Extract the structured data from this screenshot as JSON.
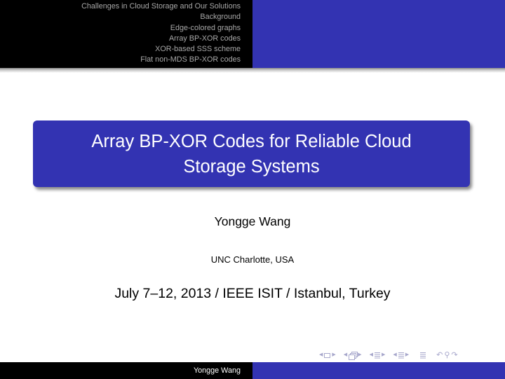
{
  "header": {
    "sections": [
      "Challenges in Cloud Storage and Our Solutions",
      "Background",
      "Edge-colored graphs",
      "Array BP-XOR codes",
      "XOR-based SSS scheme",
      "Flat non-MDS BP-XOR codes"
    ]
  },
  "title": {
    "line1": "Array BP-XOR Codes for Reliable Cloud",
    "line2": "Storage Systems"
  },
  "author": "Yongge Wang",
  "institute": "UNC Charlotte, USA",
  "date": "July 7–12, 2013 / IEEE ISIT / Istanbul, Turkey",
  "footer": {
    "author": "Yongge Wang"
  },
  "navigation": {
    "icons": [
      "slide-prev-icon",
      "slide-icon",
      "slide-next-icon",
      "frame-prev-icon",
      "frame-icon",
      "frame-next-icon",
      "subsection-prev-icon",
      "subsection-icon",
      "subsection-next-icon",
      "section-prev-icon",
      "section-icon",
      "section-next-icon",
      "align-icon",
      "back-icon",
      "search-icon",
      "forward-icon"
    ],
    "glyphs": {
      "left": "◀",
      "right": "▶",
      "back": "↶",
      "search": "⚲",
      "forward": "↷",
      "align": "≡"
    }
  },
  "colors": {
    "theme_blue": "#3333b2",
    "header_black": "#000000",
    "header_text": "#a8a8a8",
    "nav_icon": "#a8a8cc"
  }
}
